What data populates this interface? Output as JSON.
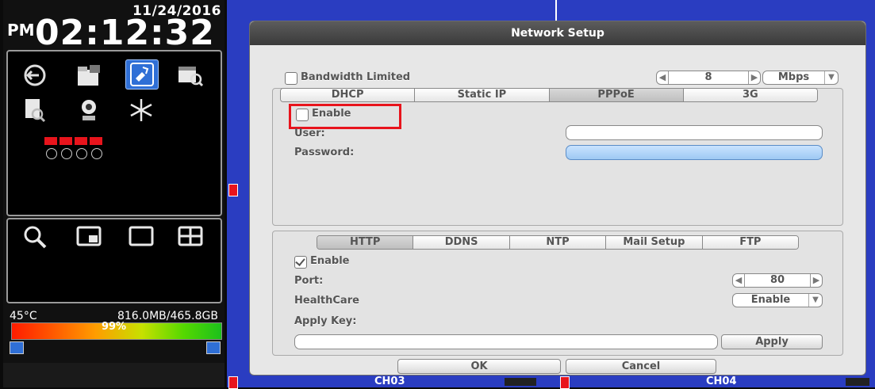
{
  "status": {
    "date": "11/24/2016",
    "ampm": "PM",
    "time": "02:12:32",
    "temperature": "45°C",
    "disk_usage": "816.0MB/465.8GB",
    "disk_percent": 99,
    "disk_percent_label": "99%"
  },
  "left_icons": {
    "top": [
      "back-icon",
      "folder-icon",
      "display-setup-icon",
      "calendar-search-icon",
      "document-search-icon",
      "camera-icon",
      "freeze-icon"
    ],
    "bottom": [
      "search-icon",
      "pip-view-icon",
      "single-view-icon",
      "quad-view-icon"
    ]
  },
  "dialog": {
    "title": "Network Setup",
    "bandwidth": {
      "label": "Bandwidth Limited",
      "checked": false,
      "value": "8",
      "unit": "Mbps"
    },
    "conn_tabs": [
      "DHCP",
      "Static IP",
      "PPPoE",
      "3G"
    ],
    "conn_active": "PPPoE",
    "pppoe": {
      "enable_label": "Enable",
      "enable_checked": false,
      "user_label": "User:",
      "user_value": "",
      "password_label": "Password:",
      "password_value": ""
    },
    "svc_tabs": [
      "HTTP",
      "DDNS",
      "NTP",
      "Mail Setup",
      "FTP"
    ],
    "svc_active": "HTTP",
    "http": {
      "enable_label": "Enable",
      "enable_checked": true,
      "port_label": "Port:",
      "port_value": "80",
      "healthcare_label": "HealthCare",
      "healthcare_value": "Enable",
      "apply_key_label": "Apply Key:",
      "apply_key_value": "",
      "apply_button": "Apply"
    },
    "ok_button": "OK",
    "cancel_button": "Cancel"
  },
  "channels": {
    "left": "CH03",
    "right": "CH04"
  },
  "colors": {
    "video_bg": "#2a3dc1",
    "highlight": "#e8141c",
    "selected_icon": "#2f6fd6"
  }
}
